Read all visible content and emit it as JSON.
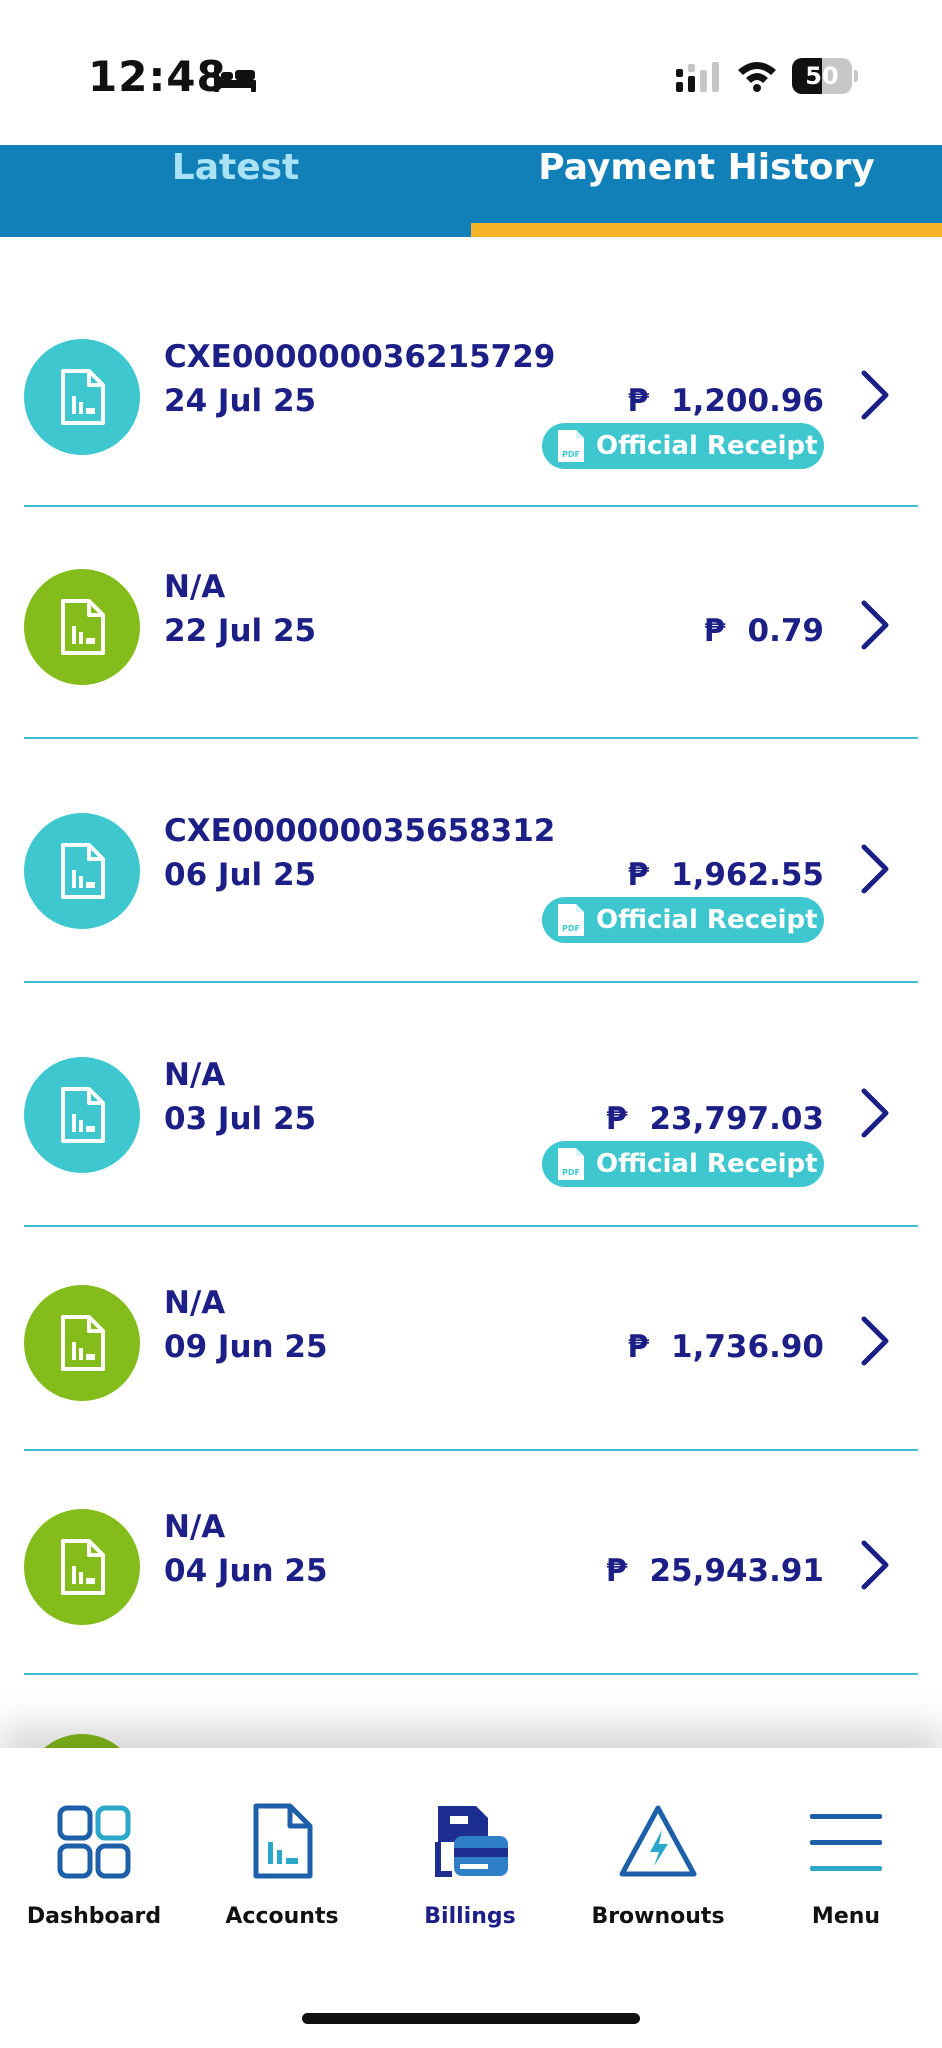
{
  "status_bar": {
    "time": "12:48",
    "battery": "50",
    "battery_level": 0.5
  },
  "tabs": [
    {
      "label": "Latest",
      "active": false
    },
    {
      "label": "Payment History",
      "active": true
    }
  ],
  "currency_symbol": "₱",
  "receipt_label": "Official Receipt",
  "payments": [
    {
      "reference": "CXE000000036215729",
      "date": "24 Jul 25",
      "amount": "1,200.96",
      "has_receipt": true,
      "icon_color": "teal"
    },
    {
      "reference": "N/A",
      "date": "22 Jul 25",
      "amount": "0.79",
      "has_receipt": false,
      "icon_color": "green"
    },
    {
      "reference": "CXE000000035658312",
      "date": "06 Jul 25",
      "amount": "1,962.55",
      "has_receipt": true,
      "icon_color": "teal"
    },
    {
      "reference": "N/A",
      "date": "03 Jul 25",
      "amount": "23,797.03",
      "has_receipt": true,
      "icon_color": "teal"
    },
    {
      "reference": "N/A",
      "date": "09 Jun 25",
      "amount": "1,736.90",
      "has_receipt": false,
      "icon_color": "green"
    },
    {
      "reference": "N/A",
      "date": "04 Jun 25",
      "amount": "25,943.91",
      "has_receipt": false,
      "icon_color": "green"
    }
  ],
  "bottom_nav": [
    {
      "label": "Dashboard",
      "icon": "dashboard-grid-icon",
      "active": false
    },
    {
      "label": "Accounts",
      "icon": "accounts-document-icon",
      "active": false
    },
    {
      "label": "Billings",
      "icon": "billings-card-icon",
      "active": true
    },
    {
      "label": "Brownouts",
      "icon": "brownouts-warning-icon",
      "active": false
    },
    {
      "label": "Menu",
      "icon": "menu-icon",
      "active": false
    }
  ],
  "colors": {
    "tab_bar": "#1280b8",
    "tab_underline": "#f6b326",
    "teal": "#3fc7d0",
    "green": "#84bd1b",
    "navy_text": "#1c1f85"
  }
}
